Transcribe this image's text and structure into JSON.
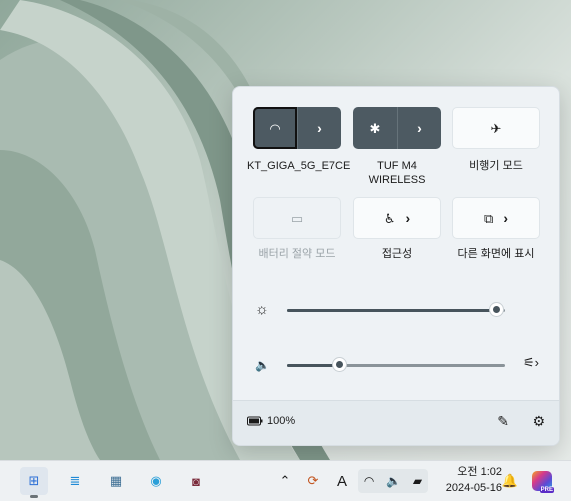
{
  "quick_settings": {
    "tiles": [
      {
        "name": "wifi",
        "label": "KT_GIGA_5G_E7CE",
        "icon": "wifi-icon",
        "glyph": "◠",
        "state": "on",
        "expand": "›"
      },
      {
        "name": "bluetooth",
        "label": "TUF M4\nWIRELESS",
        "icon": "bluetooth-icon",
        "glyph": "✱",
        "state": "on",
        "expand": "›"
      },
      {
        "name": "airplane",
        "label": "비행기 모드",
        "icon": "airplane-icon",
        "glyph": "✈",
        "state": "off"
      },
      {
        "name": "battery-saver",
        "label": "배터리 절약 모드",
        "icon": "battery-saver-icon",
        "glyph": "▭",
        "state": "disabled"
      },
      {
        "name": "accessibility",
        "label": "접근성",
        "icon": "accessibility-icon",
        "glyph": "♿",
        "state": "off",
        "expand": "›"
      },
      {
        "name": "project",
        "label": "다른 화면에 표시",
        "icon": "project-icon",
        "glyph": "⧉",
        "state": "off",
        "expand": "›"
      }
    ],
    "brightness": {
      "icon": "brightness-icon",
      "glyph": "☼",
      "level": 0.96
    },
    "volume": {
      "icon": "volume-icon",
      "glyph": "🔈",
      "level": 0.24,
      "mixer_glyph": "⚟›"
    },
    "battery": {
      "icon": "battery-charging-icon",
      "percent": "100%"
    },
    "edit_glyph": "✎",
    "settings_glyph": "⚙"
  },
  "taskbar": {
    "apps": [
      {
        "name": "task-view",
        "glyph": "⊞",
        "color": "#2b6fd6"
      },
      {
        "name": "notepad",
        "glyph": "≣",
        "color": "#1f8ad6"
      },
      {
        "name": "calculator",
        "glyph": "▦",
        "color": "#3c6e93"
      },
      {
        "name": "edge",
        "glyph": "◉",
        "color": "#2a9fd8"
      },
      {
        "name": "camera-app",
        "glyph": "◙",
        "color": "#7a2a3a"
      }
    ],
    "tray": {
      "overflow_glyph": "⌃",
      "sync_glyph": "⟳",
      "ime": "A",
      "wifi_glyph": "◠",
      "volume_glyph": "🔈",
      "battery_glyph": "▰"
    },
    "clock": {
      "time": "오전 1:02",
      "date": "2024-05-16"
    },
    "notification_glyph": "🔔",
    "copilot_badge": "PRE"
  }
}
